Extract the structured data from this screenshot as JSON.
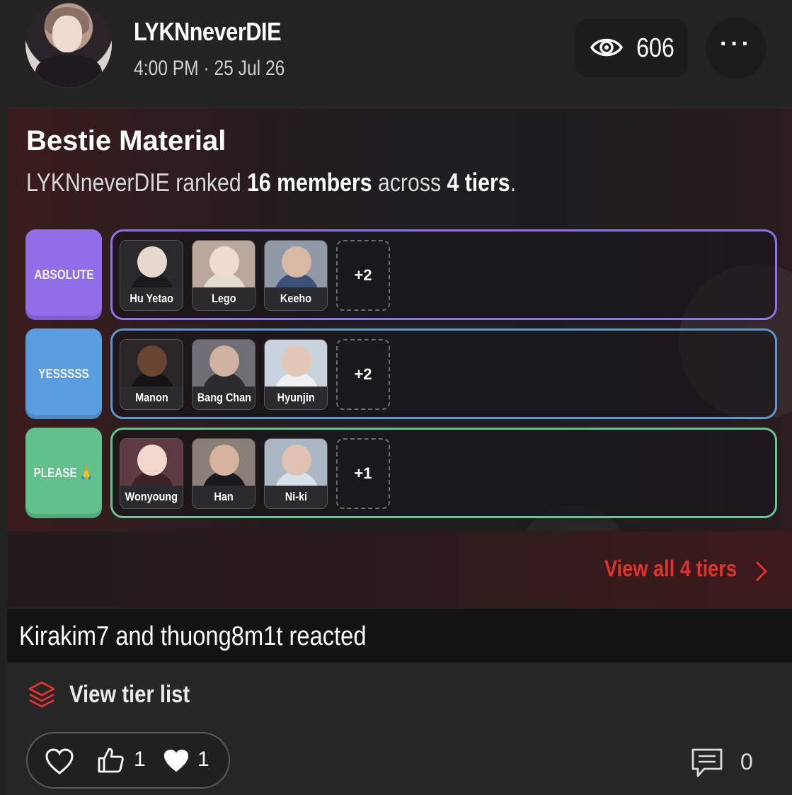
{
  "post": {
    "username": "LYKNneverDIE",
    "timestamp": "4:00 PM · 25 Jul 26",
    "views": "606",
    "more_label": "···"
  },
  "card": {
    "title": "Bestie Material",
    "sub_user": "LYKNneverDIE",
    "sub_ranked": " ranked ",
    "sub_members": "16 members",
    "sub_across": " across ",
    "sub_tiers": "4 tiers",
    "sub_end": ".",
    "view_all": "View all 4 tiers",
    "tiers": [
      {
        "label": "ABSOLUTE",
        "color": "#8f6ee8",
        "border": "#8e74ea",
        "members": [
          "Hu Yetao",
          "Lego",
          "Keeho"
        ],
        "more": "+2"
      },
      {
        "label": "YESSSSS",
        "color": "#5b9ee0",
        "border": "#5d97cf",
        "members": [
          "Manon",
          "Bang Chan",
          "Hyunjin"
        ],
        "more": "+2"
      },
      {
        "label": "PLEASE 🙏",
        "color": "#62c08d",
        "border": "#67c593",
        "members": [
          "Wonyoung",
          "Han",
          "Ni-ki"
        ],
        "more": "+1"
      }
    ]
  },
  "reactions": {
    "user1": "Kirakim7",
    "and": " and ",
    "user2": "thuong8m1t",
    "suffix": " reacted"
  },
  "footer": {
    "view_tier_list": "View tier list",
    "like_count": "1",
    "heart_count": "1",
    "comment_count": "0"
  },
  "colors": {
    "accent_red": "#e3322e"
  },
  "icons": [
    "eye-icon",
    "more-icon",
    "chevron-right-icon",
    "layers-icon",
    "heart-outline-icon",
    "thumbs-up-icon",
    "heart-filled-icon",
    "comment-icon"
  ]
}
